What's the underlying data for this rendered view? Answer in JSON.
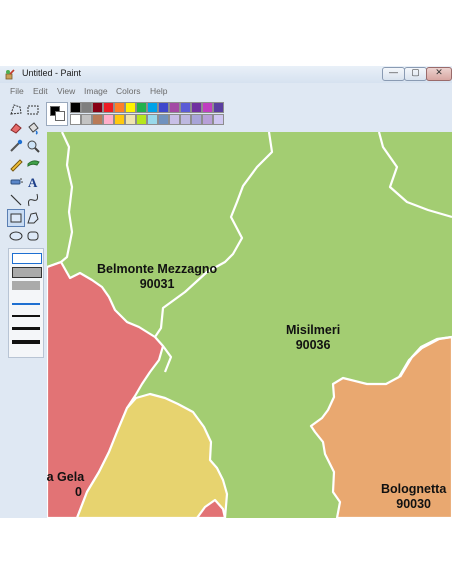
{
  "window": {
    "title": "Untitled - Paint",
    "controls": {
      "minimize": "—",
      "maximize": "▢",
      "close": "✕"
    }
  },
  "menu": [
    "File",
    "Edit",
    "View",
    "Image",
    "Colors",
    "Help"
  ],
  "tools": [
    "free-form-select-icon",
    "select-icon",
    "eraser-icon",
    "fill-icon",
    "color-picker-icon",
    "magnifier-icon",
    "pencil-icon",
    "brush-icon",
    "airbrush-icon",
    "text-icon",
    "line-icon",
    "curve-icon",
    "rectangle-icon",
    "polygon-icon",
    "ellipse-icon",
    "rounded-rectangle-icon"
  ],
  "selected_tool": "rectangle-icon",
  "palette": {
    "foreground": "#000000",
    "background": "#ffffff",
    "row1": [
      "#000000",
      "#7f7f7f",
      "#880015",
      "#ed1c24",
      "#ff7f27",
      "#fff200",
      "#22b14c",
      "#00a2e8",
      "#3f48cc",
      "#a349a4",
      "#5b5bd6",
      "#7030a0",
      "#c03ec0",
      "#5a3ea0"
    ],
    "row2": [
      "#ffffff",
      "#c3c3c3",
      "#b97a57",
      "#ffaec9",
      "#ffc90e",
      "#efe4b0",
      "#b5e61d",
      "#99d9ea",
      "#7092be",
      "#c8bfe7",
      "#bdb8e0",
      "#a8a4d8",
      "#b8a0d8",
      "#cfc7f0"
    ]
  },
  "map": {
    "colors": {
      "green": "#a3cd72",
      "red": "#e27375",
      "yellow": "#e7d36f",
      "orange": "#e9a870",
      "border": "#ffffff"
    },
    "regions": [
      {
        "name": "Belmonte Mezzagno",
        "code": "90031"
      },
      {
        "name": "Misilmeri",
        "code": "90036"
      },
      {
        "name": "na Gela",
        "code": "0"
      },
      {
        "name": "Bolognetta",
        "code": "90030"
      }
    ]
  }
}
